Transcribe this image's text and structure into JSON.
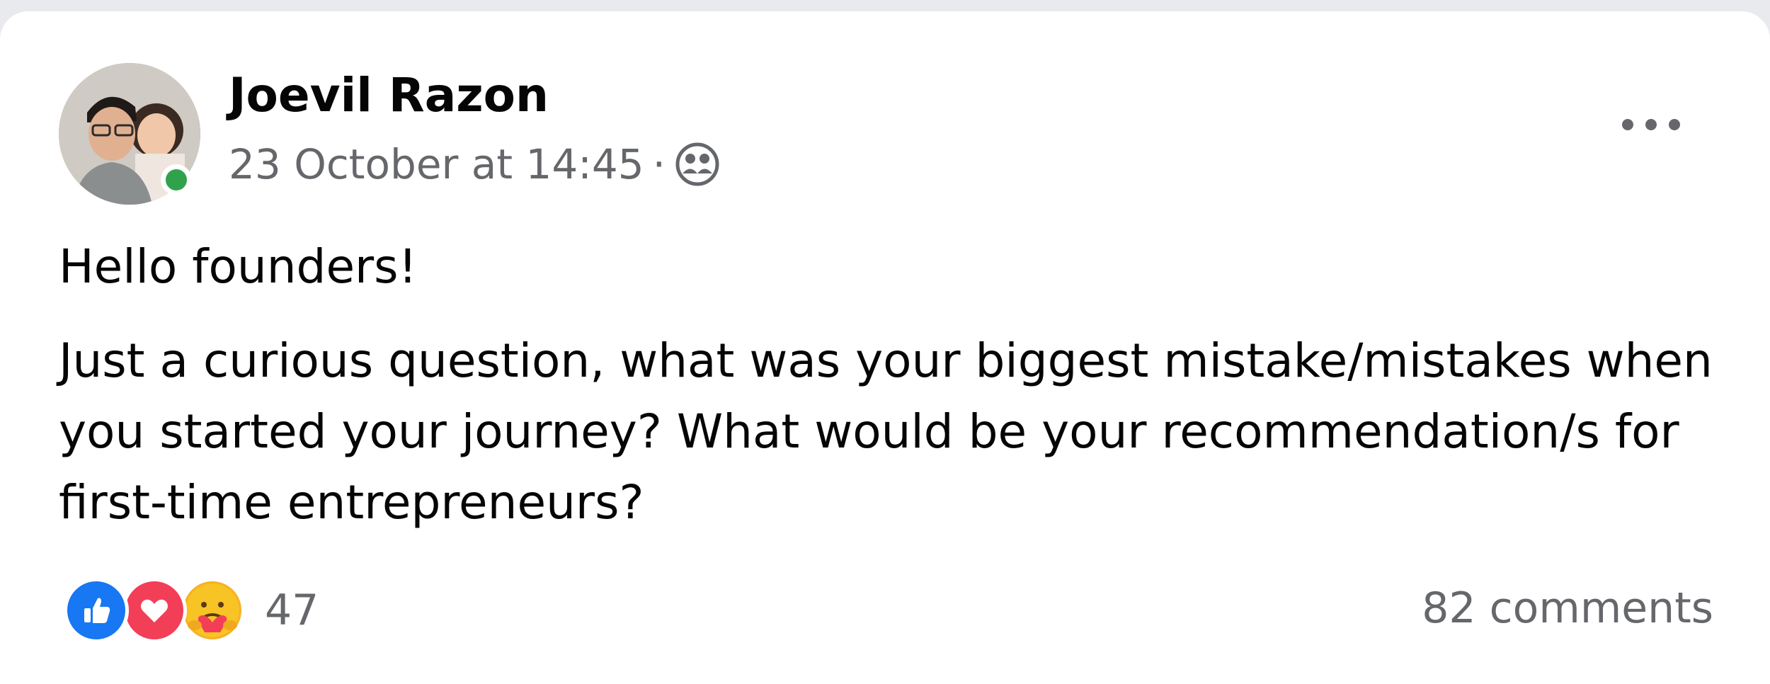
{
  "post": {
    "author": "Joevil Razon",
    "timestamp": "23 October at 14:45",
    "separator": "·",
    "audience_icon": "group-audience-icon",
    "greeting": "Hello founders!",
    "body": "Just a curious question, what was your biggest mistake/mistakes when you started your journey? What would be your recommendation/s for first-time entrepreneurs?",
    "reactions": {
      "icons": [
        "like-icon",
        "love-icon",
        "care-icon"
      ],
      "count": "47"
    },
    "comments_label": "82 comments"
  },
  "colors": {
    "online": "#31a24c",
    "like": "#1877f2",
    "love": "#f33e58",
    "care": "#f7b125",
    "secondary_text": "#65676b"
  }
}
